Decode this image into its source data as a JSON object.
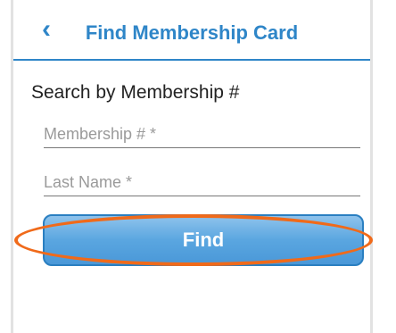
{
  "header": {
    "back_icon": "chevron-left-icon",
    "title": "Find Membership Card"
  },
  "search": {
    "section_title": "Search by Membership #",
    "membership_placeholder": "Membership # *",
    "lastname_placeholder": "Last Name *",
    "find_label": "Find"
  },
  "colors": {
    "accent": "#2f86c8",
    "annotation": "#f06a1a"
  }
}
